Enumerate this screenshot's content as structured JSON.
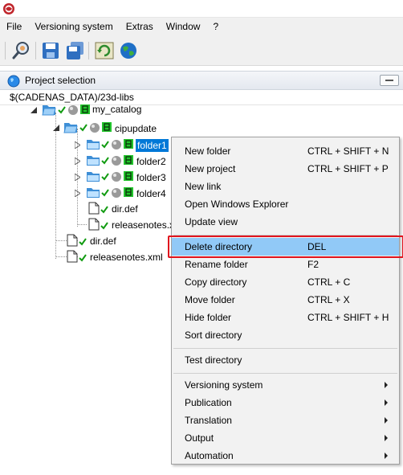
{
  "menubar": {
    "items": [
      "File",
      "Versioning system",
      "Extras",
      "Window",
      "?"
    ]
  },
  "toolbar": {
    "buttons": [
      "search-icon",
      "save-icon",
      "save-all-icon",
      "refresh-icon",
      "globe-icon"
    ]
  },
  "panel": {
    "title": "Project selection"
  },
  "path": "$(CADENAS_DATA)/23d-libs",
  "tree": {
    "root": "my_catalog",
    "child": "cipupdate",
    "folders": [
      "folder1",
      "folder2",
      "folder3",
      "folder4"
    ],
    "files_inner": [
      "dir.def",
      "releasenotes.xml"
    ],
    "files_outer": [
      "dir.def",
      "releasenotes.xml"
    ]
  },
  "context_menu": {
    "group1": [
      {
        "label": "New folder",
        "shortcut": "CTRL + SHIFT + N"
      },
      {
        "label": "New project",
        "shortcut": "CTRL + SHIFT + P"
      },
      {
        "label": "New link",
        "shortcut": ""
      },
      {
        "label": "Open Windows Explorer",
        "shortcut": ""
      },
      {
        "label": "Update view",
        "shortcut": ""
      }
    ],
    "group2": [
      {
        "label": "Delete directory",
        "shortcut": "DEL"
      },
      {
        "label": "Rename folder",
        "shortcut": "F2"
      },
      {
        "label": "Copy directory",
        "shortcut": "CTRL + C"
      },
      {
        "label": "Move folder",
        "shortcut": "CTRL + X"
      },
      {
        "label": "Hide folder",
        "shortcut": "CTRL + SHIFT + H"
      },
      {
        "label": "Sort directory",
        "shortcut": ""
      }
    ],
    "group3": [
      {
        "label": "Test directory",
        "shortcut": ""
      }
    ],
    "submenus": [
      "Versioning system",
      "Publication",
      "Translation",
      "Output",
      "Automation"
    ]
  },
  "colors": {
    "selection": "#0078d7",
    "menu_hover": "#91c9f7",
    "annotation_red": "#e0141e",
    "status_green": "#22c52c"
  }
}
